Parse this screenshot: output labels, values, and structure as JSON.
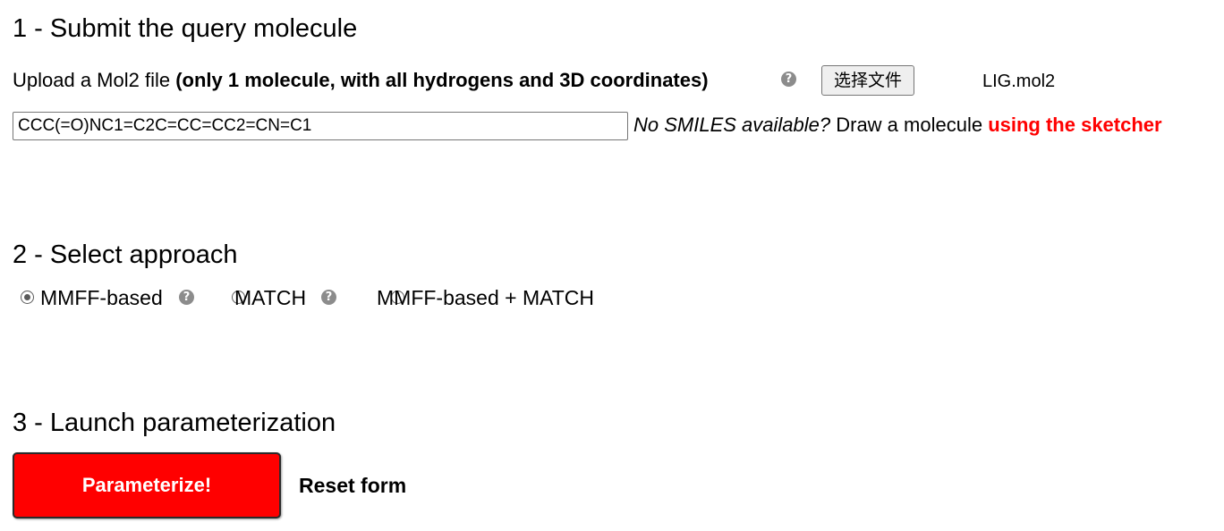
{
  "section1": {
    "title": "1 - Submit the query molecule",
    "upload_label": "Upload a Mol2 file ",
    "upload_hint": "(only 1 molecule, with all hydrogens and 3D coordinates)",
    "help_icon": "?",
    "file_button_label": "选择文件",
    "file_name": "LIG.mol2",
    "smiles_value": "CCC(=O)NC1=C2C=CC=CC2=CN=C1",
    "smiles_hint_italic": "No SMILES available?",
    "smiles_hint_text": " Draw a molecule ",
    "sketcher_link": "using the sketcher",
    "sketcher_color": "#ff0000"
  },
  "section2": {
    "title": "2 - Select approach",
    "options": [
      {
        "label": "MMFF-based",
        "checked": true,
        "has_help": true
      },
      {
        "label": "MATCH",
        "checked": false,
        "has_help": true
      },
      {
        "label": "MMFF-based + MATCH",
        "checked": false,
        "has_help": false
      }
    ],
    "help_icon": "?"
  },
  "section3": {
    "title": "3 - Launch parameterization",
    "submit_label": "Parameterize!",
    "submit_color": "#ff0000",
    "reset_label": "Reset form"
  }
}
